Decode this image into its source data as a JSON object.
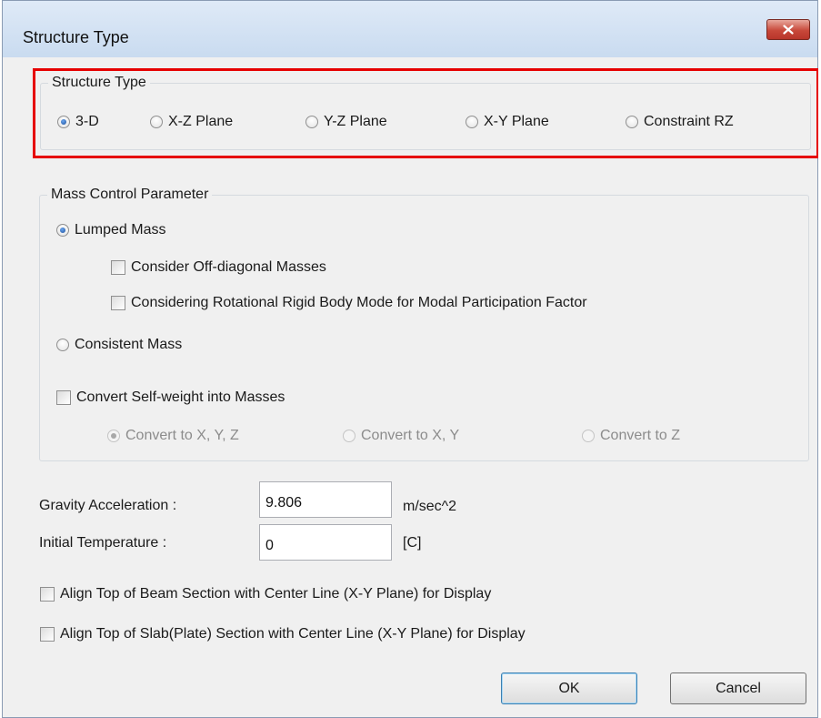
{
  "window": {
    "title": "Structure Type",
    "close_icon": "close-icon"
  },
  "structure_type": {
    "group_title": "Structure Type",
    "options": [
      "3-D",
      "X-Z Plane",
      "Y-Z Plane",
      "X-Y Plane",
      "Constraint RZ"
    ],
    "selected": "3-D"
  },
  "mass_control": {
    "group_title": "Mass Control Parameter",
    "lumped_mass": "Lumped Mass",
    "consider_off_diagonal": "Consider Off-diagonal Masses",
    "considering_rotational": "Considering Rotational Rigid Body Mode for Modal Participation Factor",
    "consistent_mass": "Consistent Mass",
    "convert_self_weight": "Convert Self-weight into Masses",
    "convert_options": [
      "Convert to X, Y, Z",
      "Convert to X, Y",
      "Convert to Z"
    ],
    "convert_selected": "Convert to X, Y, Z"
  },
  "gravity": {
    "label": "Gravity Acceleration :",
    "value": "9.806",
    "unit": "m/sec^2"
  },
  "temperature": {
    "label": "Initial Temperature :",
    "value": "0",
    "unit": "[C]"
  },
  "align_beam": "Align Top of Beam Section with Center Line (X-Y Plane) for  Display",
  "align_slab": "Align Top of Slab(Plate) Section with Center Line (X-Y Plane) for Display",
  "buttons": {
    "ok": "OK",
    "cancel": "Cancel"
  },
  "colors": {
    "highlight": "#e60000",
    "close_button": "#c8483a",
    "radio_selected": "#1d4f9a"
  }
}
